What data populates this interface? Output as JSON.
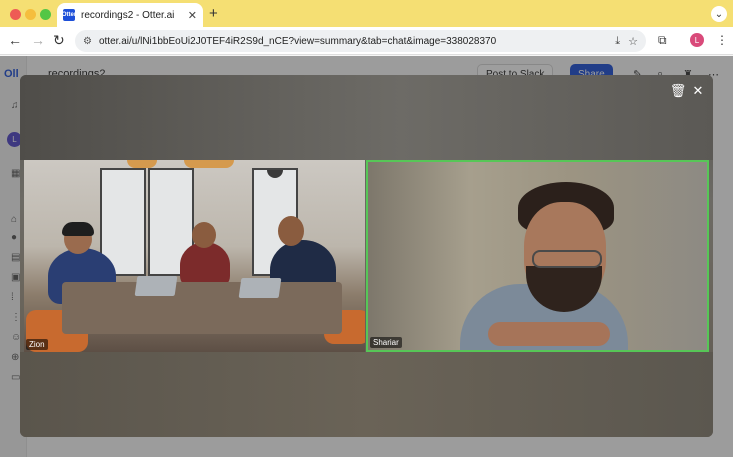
{
  "browser": {
    "tab_title": "recordings2 - Otter.ai",
    "favicon_text": "Otter",
    "new_tab": "+",
    "url": "otter.ai/u/lNi1bbEoUi2J0TEF4iR2S9d_nCE?view=summary&tab=chat&image=338028370",
    "profile_initial": "L"
  },
  "app": {
    "logo": "Oll",
    "title": "recordings2",
    "avatar_initial": "L",
    "buttons": {
      "post_to_slack": "Post to Slack",
      "share": "Share"
    }
  },
  "modal": {
    "participants": [
      {
        "name": "Zion"
      },
      {
        "name": "Shariar"
      }
    ]
  },
  "colors": {
    "tab_bar": "#f5df73",
    "active_speaker_border": "#57c657",
    "share_button": "#1d4fd8"
  },
  "icons": [
    "back-icon",
    "forward-icon",
    "reload-icon",
    "site-info-icon",
    "install-icon",
    "star-icon",
    "extensions-icon",
    "menu-icon",
    "trash-icon",
    "close-icon"
  ]
}
